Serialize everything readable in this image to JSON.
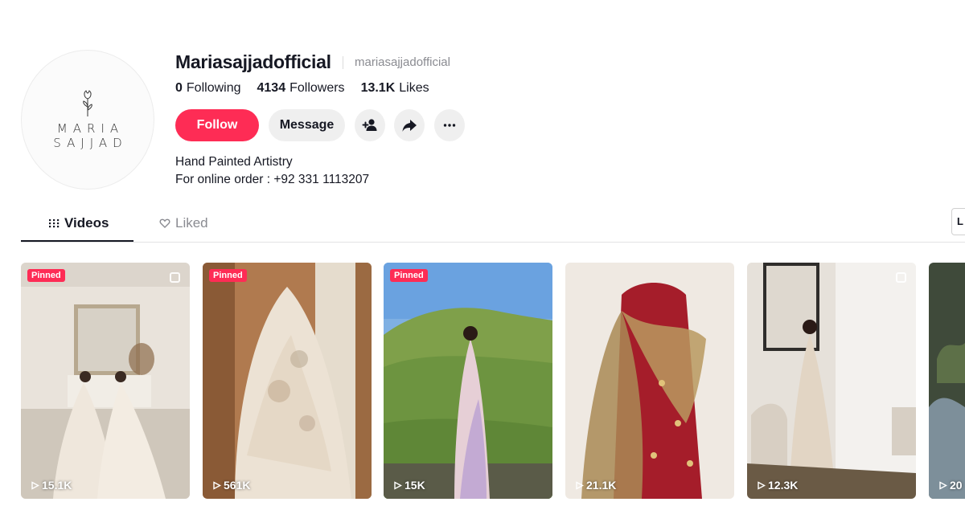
{
  "profile": {
    "avatar_line1": "MARIA",
    "avatar_line2": "SAJJAD",
    "display_name": "Mariasajjadofficial",
    "username": "mariasajjadofficial",
    "following_count": "0",
    "following_label": "Following",
    "followers_count": "4134",
    "followers_label": "Followers",
    "likes_count": "13.1K",
    "likes_label": "Likes",
    "bio_line1": "Hand Painted Artistry",
    "bio_line2": "For online order : +92 331 1113207"
  },
  "actions": {
    "follow_label": "Follow",
    "message_label": "Message",
    "icons": [
      "add-friend-icon",
      "share-icon",
      "more-icon"
    ]
  },
  "tabs": {
    "videos_label": "Videos",
    "liked_label": "Liked",
    "edge_label": "L"
  },
  "videos": [
    {
      "views": "15.1K",
      "pinned": "Pinned",
      "multi": true
    },
    {
      "views": "561K",
      "pinned": "Pinned",
      "multi": false
    },
    {
      "views": "15K",
      "pinned": "Pinned",
      "multi": false
    },
    {
      "views": "21.1K",
      "pinned": "",
      "multi": false
    },
    {
      "views": "12.3K",
      "pinned": "",
      "multi": true
    },
    {
      "views": "20",
      "pinned": "",
      "multi": false
    }
  ],
  "colors": {
    "accent": "#fe2c55",
    "text": "#161823",
    "muted": "#8a8b91",
    "button_bg": "#efefef"
  }
}
